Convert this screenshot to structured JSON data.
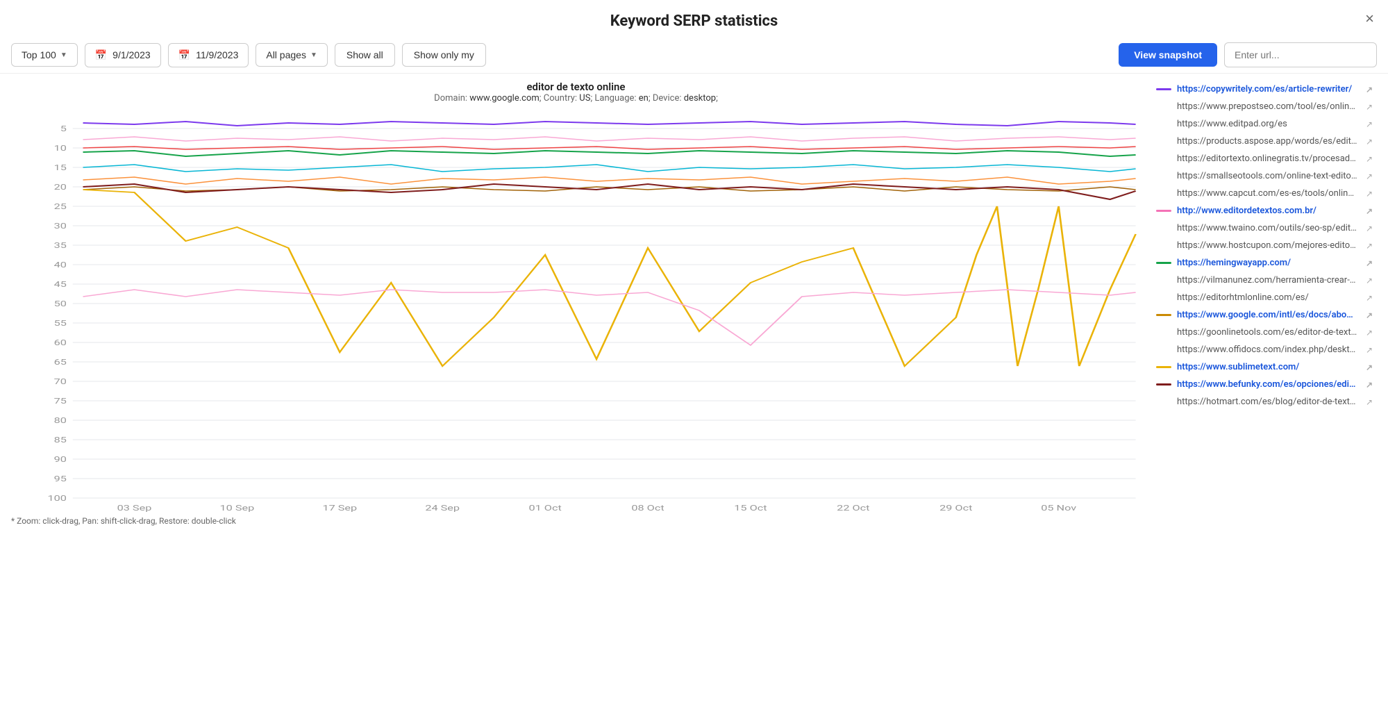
{
  "title": "Keyword SERP statistics",
  "close_label": "×",
  "toolbar": {
    "range_label": "Top 100",
    "date_start": "9/1/2023",
    "date_end": "11/9/2023",
    "pages_label": "All pages",
    "show_all_label": "Show all",
    "show_only_my_label": "Show only my",
    "view_snapshot_label": "View snapshot",
    "url_placeholder": "Enter url..."
  },
  "chart": {
    "keyword": "editor de texto online",
    "domain": "www.google.com",
    "country": "US",
    "language": "en",
    "device": "desktop",
    "meta_text": "Domain: www.google.com; Country: US; Language: en; Device: desktop;",
    "zoom_hint": "* Zoom: click-drag, Pan: shift-click-drag, Restore: double-click",
    "x_labels": [
      "03 Sep",
      "10 Sep",
      "17 Sep",
      "24 Sep",
      "01 Oct",
      "08 Oct",
      "15 Oct",
      "22 Oct",
      "29 Oct",
      "05 Nov"
    ],
    "y_labels": [
      "5",
      "10",
      "15",
      "20",
      "25",
      "30",
      "35",
      "40",
      "45",
      "50",
      "55",
      "60",
      "65",
      "70",
      "75",
      "80",
      "85",
      "90",
      "95",
      "100"
    ]
  },
  "legend": {
    "items": [
      {
        "url": "https://copywritely.com/es/article-rewriter/",
        "color": "#7c3aed",
        "highlighted": true
      },
      {
        "url": "https://www.prepostseo.com/tool/es/online-te...",
        "color": "transparent"
      },
      {
        "url": "https://www.editpad.org/es",
        "color": "transparent"
      },
      {
        "url": "https://products.aspose.app/words/es/editor/txt",
        "color": "transparent"
      },
      {
        "url": "https://editortexto.onlinegratis.tv/procesador/",
        "color": "transparent"
      },
      {
        "url": "https://smallseotools.com/online-text-editor/",
        "color": "transparent"
      },
      {
        "url": "https://www.capcut.com/es-es/tools/online-te...",
        "color": "transparent"
      },
      {
        "url": "http://www.editordetextos.com.br/",
        "color": "#f472b6",
        "highlighted": true
      },
      {
        "url": "https://www.twaino.com/outils/seo-sp/editor-...",
        "color": "transparent"
      },
      {
        "url": "https://www.hostcupon.com/mejores-editore...",
        "color": "transparent"
      },
      {
        "url": "https://hemingwayapp.com/",
        "color": "#16a34a",
        "highlighted": true
      },
      {
        "url": "https://vilmanunez.com/herramienta-crear-te...",
        "color": "transparent"
      },
      {
        "url": "https://editorhtmlonline.com/es/",
        "color": "transparent"
      },
      {
        "url": "https://www.google.com/intl/es/docs/about/",
        "color": "#ca8a04",
        "highlighted": true
      },
      {
        "url": "https://goonlinetools.com/es/editor-de-texto/",
        "color": "transparent"
      },
      {
        "url": "https://www.offidocs.com/index.php/desktop-...",
        "color": "transparent"
      },
      {
        "url": "https://www.sublimetext.com/",
        "color": "#eab308",
        "highlighted": true
      },
      {
        "url": "https://www.befunky.com/es/opciones/editor-...",
        "color": "#7f1d1d",
        "highlighted": true
      },
      {
        "url": "https://hotmart.com/es/blog/editor-de-texto...",
        "color": "transparent"
      }
    ]
  }
}
